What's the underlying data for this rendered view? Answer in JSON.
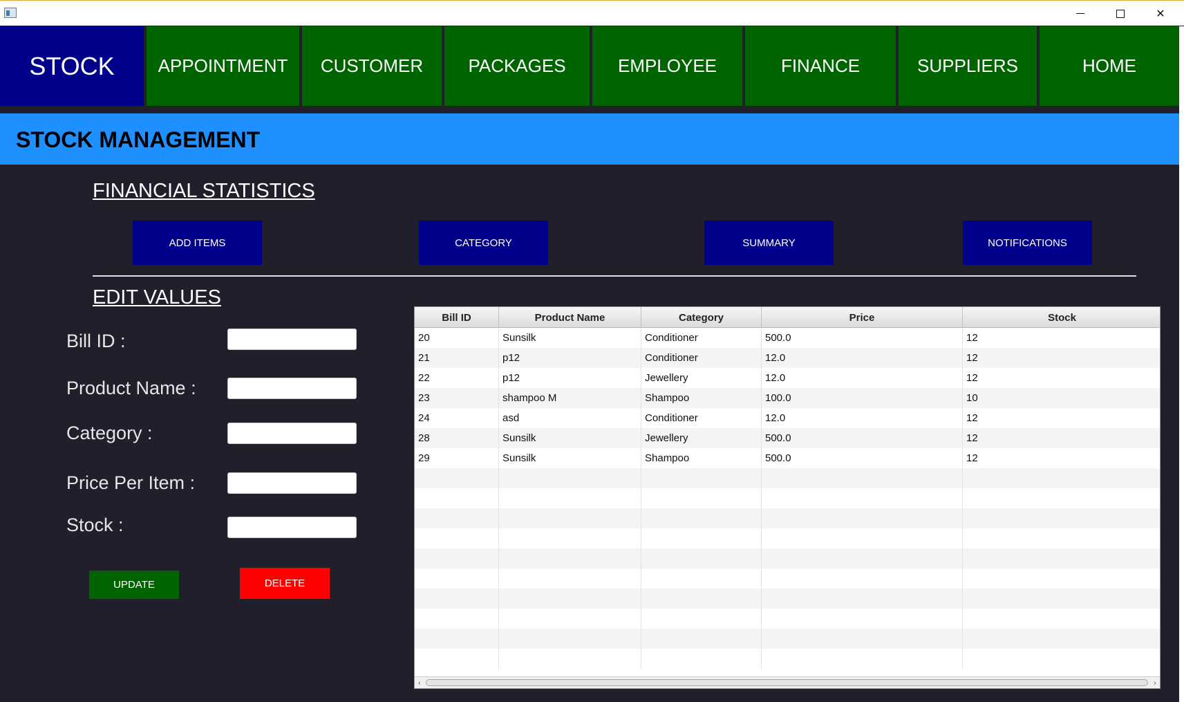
{
  "window": {
    "controls": {
      "minimize": "minimize-icon",
      "maximize": "maximize-icon",
      "close": "✕"
    }
  },
  "nav": {
    "tabs": [
      {
        "label": "STOCK",
        "active": true
      },
      {
        "label": "APPOINTMENT"
      },
      {
        "label": "CUSTOMER"
      },
      {
        "label": "PACKAGES"
      },
      {
        "label": "EMPLOYEE"
      },
      {
        "label": "FINANCE"
      },
      {
        "label": "SUPPLIERS"
      },
      {
        "label": "HOME"
      }
    ]
  },
  "header": {
    "title": "STOCK MANAGEMENT"
  },
  "financial": {
    "heading": "FINANCIAL STATISTICS",
    "buttons": [
      "ADD ITEMS",
      "CATEGORY",
      "SUMMARY",
      "NOTIFICATIONS"
    ]
  },
  "edit": {
    "heading": "EDIT VALUES",
    "fields": [
      {
        "label": "Bill ID  :",
        "value": ""
      },
      {
        "label": "Product Name :",
        "value": ""
      },
      {
        "label": "Category  :",
        "value": ""
      },
      {
        "label": "Price Per Item  :",
        "value": ""
      },
      {
        "label": "Stock  :",
        "value": ""
      }
    ],
    "update_label": "UPDATE",
    "delete_label": "DELETE"
  },
  "table": {
    "columns": [
      "Bill ID",
      "Product Name",
      "Category",
      "Price",
      "Stock"
    ],
    "rows": [
      [
        "20",
        "Sunsilk",
        "Conditioner",
        "500.0",
        "12"
      ],
      [
        "21",
        "p12",
        "Conditioner",
        "12.0",
        "12"
      ],
      [
        "22",
        "p12",
        "Jewellery",
        "12.0",
        "12"
      ],
      [
        "23",
        "shampoo M",
        "Shampoo",
        "100.0",
        "10"
      ],
      [
        "24",
        "asd",
        "Conditioner",
        "12.0",
        "12"
      ],
      [
        "28",
        "Sunsilk",
        "Jewellery",
        "500.0",
        "12"
      ],
      [
        "29",
        "Sunsilk",
        "Shampoo",
        "500.0",
        "12"
      ]
    ]
  },
  "colors": {
    "nav_active": "#00008b",
    "nav": "#006400",
    "band": "#1e90ff",
    "delete": "#ff0000",
    "background": "#201f2b"
  }
}
